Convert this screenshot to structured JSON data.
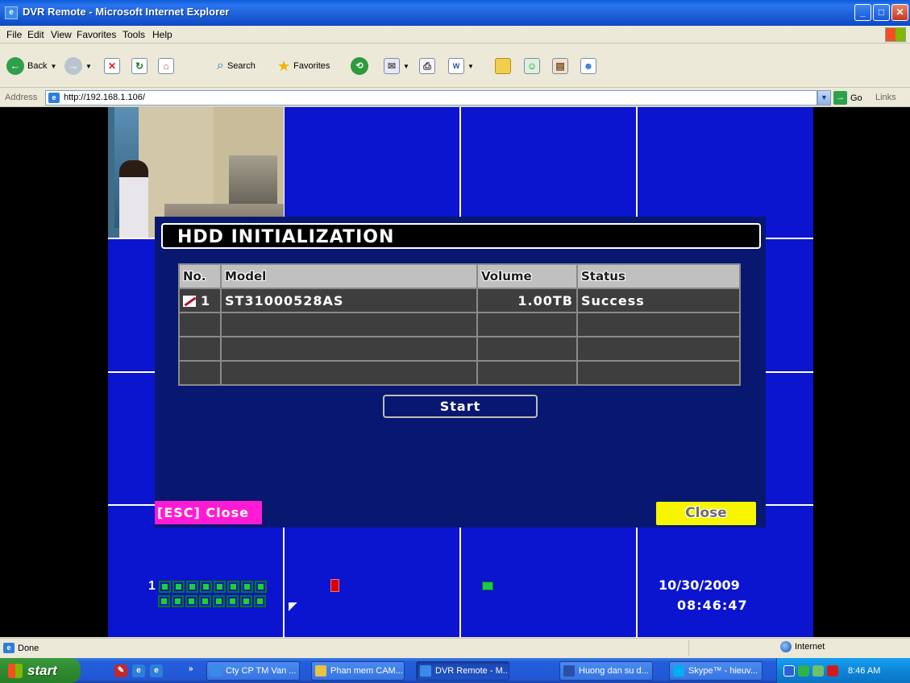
{
  "window": {
    "title": "DVR Remote - Microsoft Internet Explorer"
  },
  "menu": [
    "File",
    "Edit",
    "View",
    "Favorites",
    "Tools",
    "Help"
  ],
  "toolbar": {
    "back": "Back",
    "search": "Search",
    "favorites": "Favorites"
  },
  "address": {
    "label": "Address",
    "url": "http://192.168.1.106/",
    "go": "Go",
    "links": "Links"
  },
  "dvr": {
    "dialog_title": "HDD INITIALIZATION",
    "table": {
      "headers": [
        "No.",
        "Model",
        "Volume",
        "Status"
      ],
      "rows": [
        {
          "no": "1",
          "model": "ST31000528AS",
          "volume": "1.00TB",
          "status": "Success",
          "checked": true
        }
      ],
      "empty_rows": 3
    },
    "start_label": "Start",
    "esc_label": "[ESC] Close",
    "close_label": "Close",
    "channel_group": "1",
    "date": "10/30/2009",
    "time": "08:46:47"
  },
  "statusbar": {
    "text": "Done",
    "zone": "Internet"
  },
  "taskbar": {
    "start": "start",
    "tasks": [
      "Cty CP TM Van ...",
      "Phan mem CAM...",
      "DVR Remote - M...",
      "Huong dan su d...",
      "Skype™ - hieuv..."
    ],
    "active_task_index": 2,
    "clock": "8:46 AM"
  },
  "colors": {
    "dvr_background": "#0b14cf",
    "esc_magenta": "#ff1bd6",
    "close_yellow": "#f7f500"
  }
}
